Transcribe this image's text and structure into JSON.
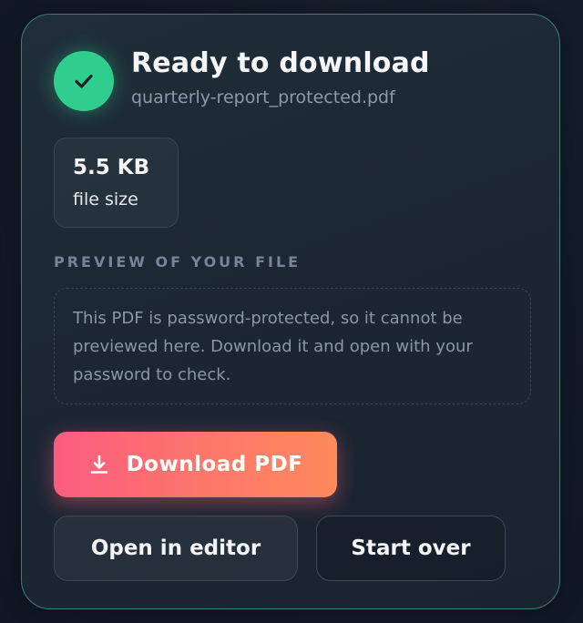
{
  "status": {
    "title": "Ready to download",
    "filename": "quarterly-report_protected.pdf",
    "icon": "check-icon",
    "accent_color": "#2fce8f"
  },
  "file_info": {
    "size_value": "5.5 KB",
    "size_label": "file size"
  },
  "preview": {
    "section_label": "PREVIEW OF YOUR FILE",
    "message": "This PDF is password-protected, so it cannot be previewed here. Download it and open with your password to check."
  },
  "actions": {
    "download_label": "Download PDF",
    "download_icon": "download-icon",
    "download_gradient": [
      "#fb5c80",
      "#fe8a5c"
    ],
    "open_editor_label": "Open in editor",
    "start_over_label": "Start over"
  }
}
